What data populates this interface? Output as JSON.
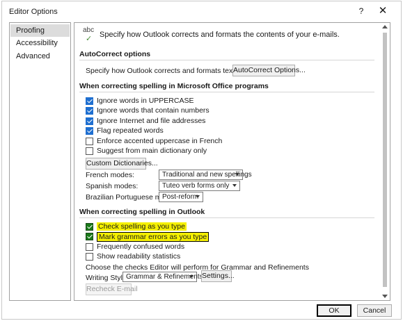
{
  "window": {
    "title": "Editor Options",
    "help": "?",
    "close": "✕"
  },
  "nav": {
    "items": [
      "Proofing",
      "Accessibility",
      "Advanced"
    ]
  },
  "intro": {
    "text": "Specify how Outlook corrects and formats the contents of your e-mails.",
    "icon_text": "abc",
    "icon_check": "✓"
  },
  "autocorrect": {
    "heading": "AutoCorrect options",
    "label": "Specify how Outlook corrects and formats text as you type.",
    "button": "AutoCorrect Options..."
  },
  "office": {
    "heading": "When correcting spelling in Microsoft Office programs",
    "options": [
      {
        "label": "Ignore words in UPPERCASE",
        "checked": true
      },
      {
        "label": "Ignore words that contain numbers",
        "checked": true
      },
      {
        "label": "Ignore Internet and file addresses",
        "checked": true
      },
      {
        "label": "Flag repeated words",
        "checked": true
      },
      {
        "label": "Enforce accented uppercase in French",
        "checked": false
      },
      {
        "label": "Suggest from main dictionary only",
        "checked": false
      }
    ],
    "custom_dict_button": "Custom Dictionaries...",
    "french_label": "French modes:",
    "french_value": "Traditional and new spellings",
    "spanish_label": "Spanish modes:",
    "spanish_value": "Tuteo verb forms only",
    "portuguese_label": "Brazilian Portuguese modes:",
    "portuguese_value": "Post-reform"
  },
  "outlook": {
    "heading": "When correcting spelling in Outlook",
    "options": [
      {
        "label": "Check spelling as you type",
        "checked": true
      },
      {
        "label": "Mark grammar errors as you type",
        "checked": true
      },
      {
        "label": "Frequently confused words",
        "checked": false
      },
      {
        "label": "Show readability statistics",
        "checked": false
      }
    ],
    "grammar_label": "Choose the checks Editor will perform for Grammar and Refinements",
    "writing_style_label": "Writing Style:",
    "writing_style_value": "Grammar & Refinements",
    "settings_button": "Settings...",
    "recheck_button": "Recheck E-mail"
  },
  "footer": {
    "ok": "OK",
    "cancel": "Cancel"
  }
}
